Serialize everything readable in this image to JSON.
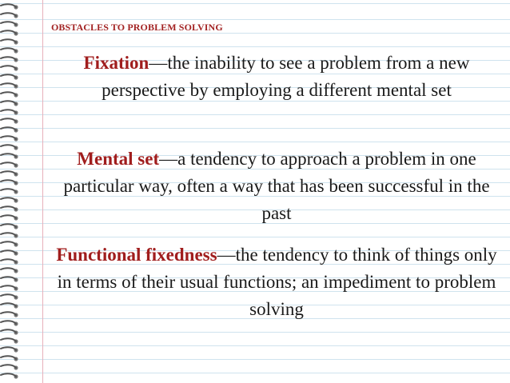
{
  "title": "OBSTACLES TO PROBLEM SOLVING",
  "definitions": [
    {
      "term": "Fixation",
      "text": "—the inability to see a problem from a new perspective by employing a different mental set"
    },
    {
      "term": "Mental set",
      "text": "—a tendency to approach a problem in one particular way, often a way that has been successful in the past"
    },
    {
      "term": "Functional fixedness",
      "text": "—the tendency to think of things only in terms of their usual functions; an impediment to problem solving"
    }
  ],
  "colors": {
    "term": "#a01d1d",
    "title": "#a32424",
    "rule_lines": "#cfe3ee",
    "margin_line": "#e7b1bb"
  }
}
